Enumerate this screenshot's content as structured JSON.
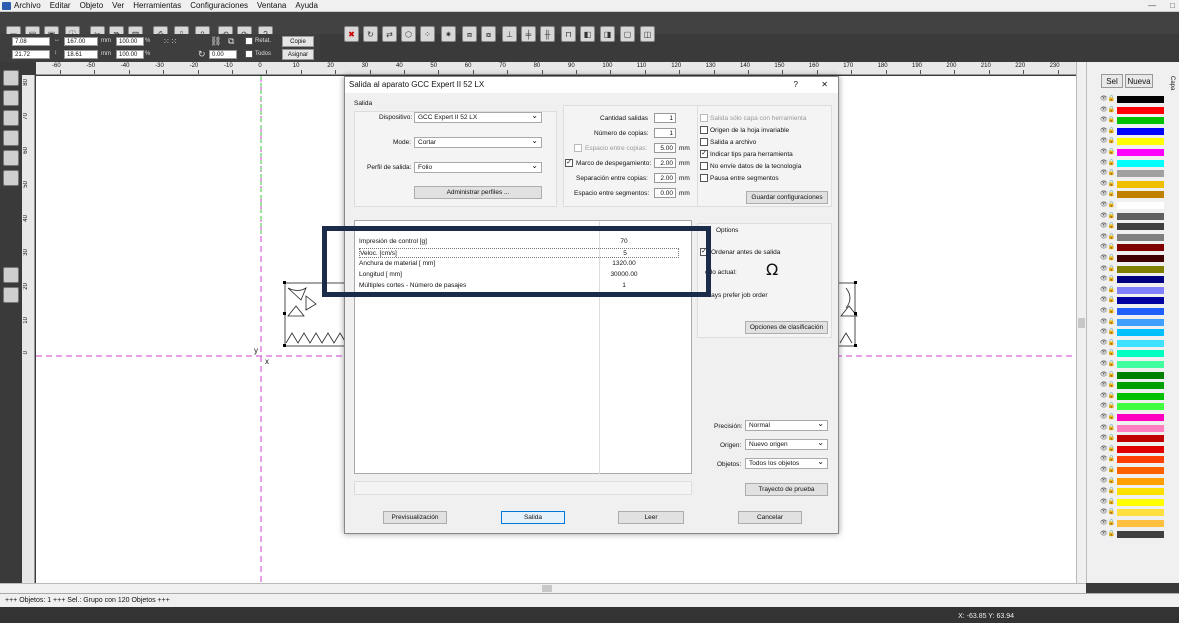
{
  "menu": [
    "Archivo",
    "Editar",
    "Objeto",
    "Ver",
    "Herramientas",
    "Configuraciones",
    "Ventana",
    "Ayuda"
  ],
  "window_controls": [
    "—",
    "□"
  ],
  "props": {
    "x": "7.08",
    "y": "21.72",
    "w": "167.00",
    "h": "18.61",
    "unit": "mm",
    "pct1": "100.00",
    "pct2": "100.00",
    "pct_sym": "%",
    "angle": "0.00",
    "retat": "Retat.",
    "todos": "Todos",
    "copie": "Copie",
    "asignar": "Asignar"
  },
  "ruler_top": [
    "-60",
    "-50",
    "-40",
    "-30",
    "-20",
    "-10",
    "0",
    "10",
    "20",
    "30",
    "40",
    "50",
    "60",
    "70",
    "80",
    "90",
    "100",
    "110",
    "120",
    "130",
    "140",
    "150",
    "160",
    "170",
    "180",
    "190",
    "200",
    "210",
    "220",
    "230"
  ],
  "ruler_unit": "mm",
  "ruler_left": [
    "80",
    "70",
    "60",
    "50",
    "40",
    "30",
    "20",
    "10",
    "0"
  ],
  "canvas": {
    "axis_y": "y",
    "axis_x": "x"
  },
  "layers": {
    "sel": "Sel",
    "nueva": "Nueva",
    "tab": "Capa",
    "colors": [
      "#000000",
      "#ff0000",
      "#00c000",
      "#0000ff",
      "#ffff00",
      "#ff00ff",
      "#00ffff",
      "#a0a0a0",
      "#f0c000",
      "#c08000",
      "#ffffff",
      "#606060",
      "#404040",
      "#808080",
      "#800000",
      "#400000",
      "#808000",
      "#000080",
      "#8080ff",
      "#0000a0",
      "#2060ff",
      "#40a0ff",
      "#00c0ff",
      "#40e0ff",
      "#00ffc0",
      "#40ffa0",
      "#008000",
      "#00a000",
      "#00c000",
      "#40ff40",
      "#ff00c0",
      "#ff80c0",
      "#c00000",
      "#e00000",
      "#ff4000",
      "#ff6000",
      "#ffa000",
      "#ffe000",
      "#ffff00",
      "#ffe040",
      "#ffc040",
      "#404040"
    ]
  },
  "dialog": {
    "title": "Salida al aparato GCC Expert II 52 LX",
    "help": "?",
    "close": "✕",
    "salida_group": "Salida",
    "dispositivo_label": "Dispositivo:",
    "dispositivo": "GCC Expert II 52 LX",
    "modo_label": "Mode:",
    "modo": "Cortar",
    "perfil_label": "Perfil de salida:",
    "perfil": "Folio",
    "admin_perfiles": "Administrar perfiles ...",
    "cantidad_label": "Cantidad salidas",
    "cantidad": "1",
    "copias_label": "Número de copias:",
    "copias": "1",
    "espacio_copias_label": "Espacio entre copias:",
    "espacio_copias": "5.00",
    "marco_label": "Marco de despegamiento:",
    "marco": "2.00",
    "separacion_label": "Separación entre copias:",
    "separacion": "2.00",
    "segmentos_label": "Espacio entre segmentos:",
    "segmentos": "0.00",
    "mm": "mm",
    "checks": [
      "Salida sólo capa con herramienta",
      "Origen de la hoja invariable",
      "Salida a archivo",
      "Indicar tips para herramienta",
      "No envíe datos de la tecnología",
      "Pausa entre segmentos"
    ],
    "guardar": "Guardar configuraciones",
    "params": [
      {
        "name": "Impresión de control [g]",
        "value": "70"
      },
      {
        "name": "Veloc. [cm/s]",
        "value": "5"
      },
      {
        "name": "Anchura de material [ mm]",
        "value": "1320.00"
      },
      {
        "name": "Longitud [ mm]",
        "value": "30000.00"
      },
      {
        "name": "Múltiples cortes - Número de pasajes",
        "value": "1"
      }
    ],
    "options_group": "Options",
    "ordenar": "Ordenar antes de salida",
    "modo_actual": "odo actual:",
    "prefer": "lways prefer job order",
    "opciones_clasif": "Opciones de clasificación",
    "precision_label": "Precisión:",
    "precision": "Normal",
    "origen_label": "Origen:",
    "origen": "Nuevo origen",
    "objetos_label": "Objetos:",
    "objetos": "Todos los objetos",
    "trayecto": "Trayecto de prueba",
    "previs": "Previsualización",
    "salida_btn": "Salida",
    "leer": "Leer",
    "cancelar": "Cancelar"
  },
  "status": "+++ Objetos: 1 +++ Sel.: Grupo con 120 Objetos +++",
  "coords": "X: -63.85 Y: 63.94"
}
